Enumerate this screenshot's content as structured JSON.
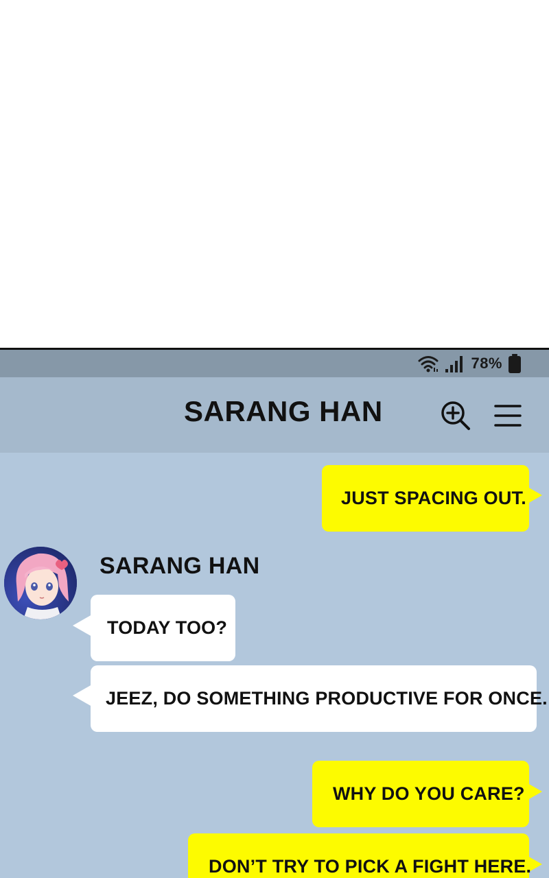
{
  "status_bar": {
    "battery_percent": "78%",
    "icons": [
      "wifi-icon",
      "signal-icon",
      "battery-icon"
    ]
  },
  "header": {
    "title": "SARANG HAN",
    "icons": [
      "zoom-in-icon",
      "menu-icon"
    ]
  },
  "messages": [
    {
      "from": "me",
      "text": "JUST SPACING OUT."
    },
    {
      "from": "them",
      "sender": "SARANG HAN",
      "text": "TODAY TOO?"
    },
    {
      "from": "them",
      "text": "JEEZ, DO SOMETHING PRODUCTIVE FOR ONCE."
    },
    {
      "from": "me",
      "text": "WHY DO YOU CARE?"
    },
    {
      "from": "me",
      "text": "DON’T TRY TO PICK A FIGHT HERE."
    }
  ],
  "colors": {
    "my_bubble": "#fdfb00",
    "their_bubble": "#ffffff",
    "chat_background": "#b2c7dc",
    "header_background": "#a5b9cc",
    "status_bar": "#8698a8"
  }
}
